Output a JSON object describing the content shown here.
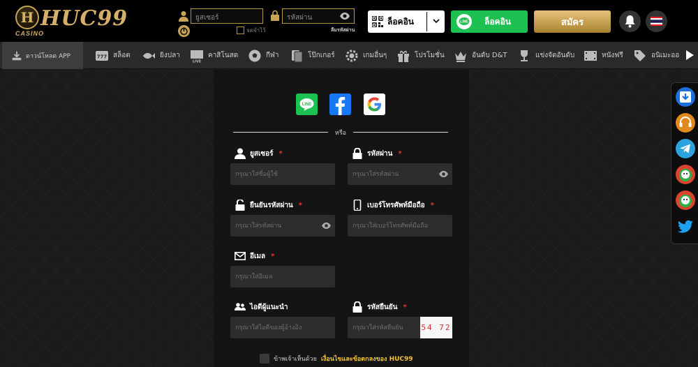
{
  "header": {
    "brand": "HUC99",
    "brand_mark": "H",
    "brand_sub": "CASINO",
    "username_placeholder": "ยูสเซอร์",
    "password_placeholder": "รหัสผ่าน",
    "remember_label": "จดจำไว้",
    "forgot_label": "ลืมรหัสผ่าน",
    "qr_login_label": "ล็อคอิน",
    "line_login_label": "ล็อคอิน",
    "signup_label": "สมัคร"
  },
  "nav": {
    "download_label": "ดาวน์โหลด APP",
    "items": [
      {
        "label": "สล็อต",
        "icon": "slot-icon"
      },
      {
        "label": "ยิงปลา",
        "icon": "fish-icon"
      },
      {
        "label": "คาสิโนสด",
        "icon": "live-casino-icon"
      },
      {
        "label": "กีฬา",
        "icon": "soccer-ball-icon"
      },
      {
        "label": "โป๊กเกอร์",
        "icon": "cards-icon"
      },
      {
        "label": "เกมอื่นๆ",
        "icon": "gear-icon"
      },
      {
        "label": "โปรโมชั่น",
        "icon": "gift-icon"
      },
      {
        "label": "อันดับ D&T",
        "icon": "crown-icon"
      },
      {
        "label": "แข่งจัดอันดับ",
        "icon": "trophy-icon"
      },
      {
        "label": "หนังฟรี",
        "icon": "film-icon"
      },
      {
        "label": "อนิเมะออ",
        "icon": "tag-icon"
      }
    ]
  },
  "form": {
    "or_text": "หรือ",
    "username": {
      "label": "ยูสเซอร์",
      "placeholder": "กรุณาใส่ชื่อผู้ใช้"
    },
    "password": {
      "label": "รหัสผ่าน",
      "placeholder": "กรุณาใส่รหัสผ่าน"
    },
    "confirm_password": {
      "label": "ยืนยันรหัสผ่าน",
      "placeholder": "กรุณาใส่รหัสผ่าน"
    },
    "phone": {
      "label": "เบอร์โทรศัพท์มือถือ",
      "placeholder": "กรุณาใส่เบอร์โทรศัพท์มือถือ"
    },
    "email": {
      "label": "อีเมล",
      "placeholder": "กรุณาใส่อีเมล"
    },
    "referrer": {
      "label": "ไอดีผู้แนะนำ",
      "placeholder": "กรุณาใส่ไอดีของผู้อ้างอิง"
    },
    "captcha": {
      "label": "รหัสยืนยัน",
      "placeholder": "กรุณาใส่รหัสยืนยัน",
      "code": "54 72"
    },
    "required_mark": "*",
    "terms_prefix": "ข้าพเจ้าเห็นด้วย",
    "terms_link": "เงื่อนไขและข้อตกลงของ HUC99"
  },
  "colors": {
    "gold": "#c9a354",
    "line_green": "#1dc151",
    "facebook_blue": "#1877f2",
    "required_red": "#e53935",
    "terms_link": "#f0c23a"
  }
}
